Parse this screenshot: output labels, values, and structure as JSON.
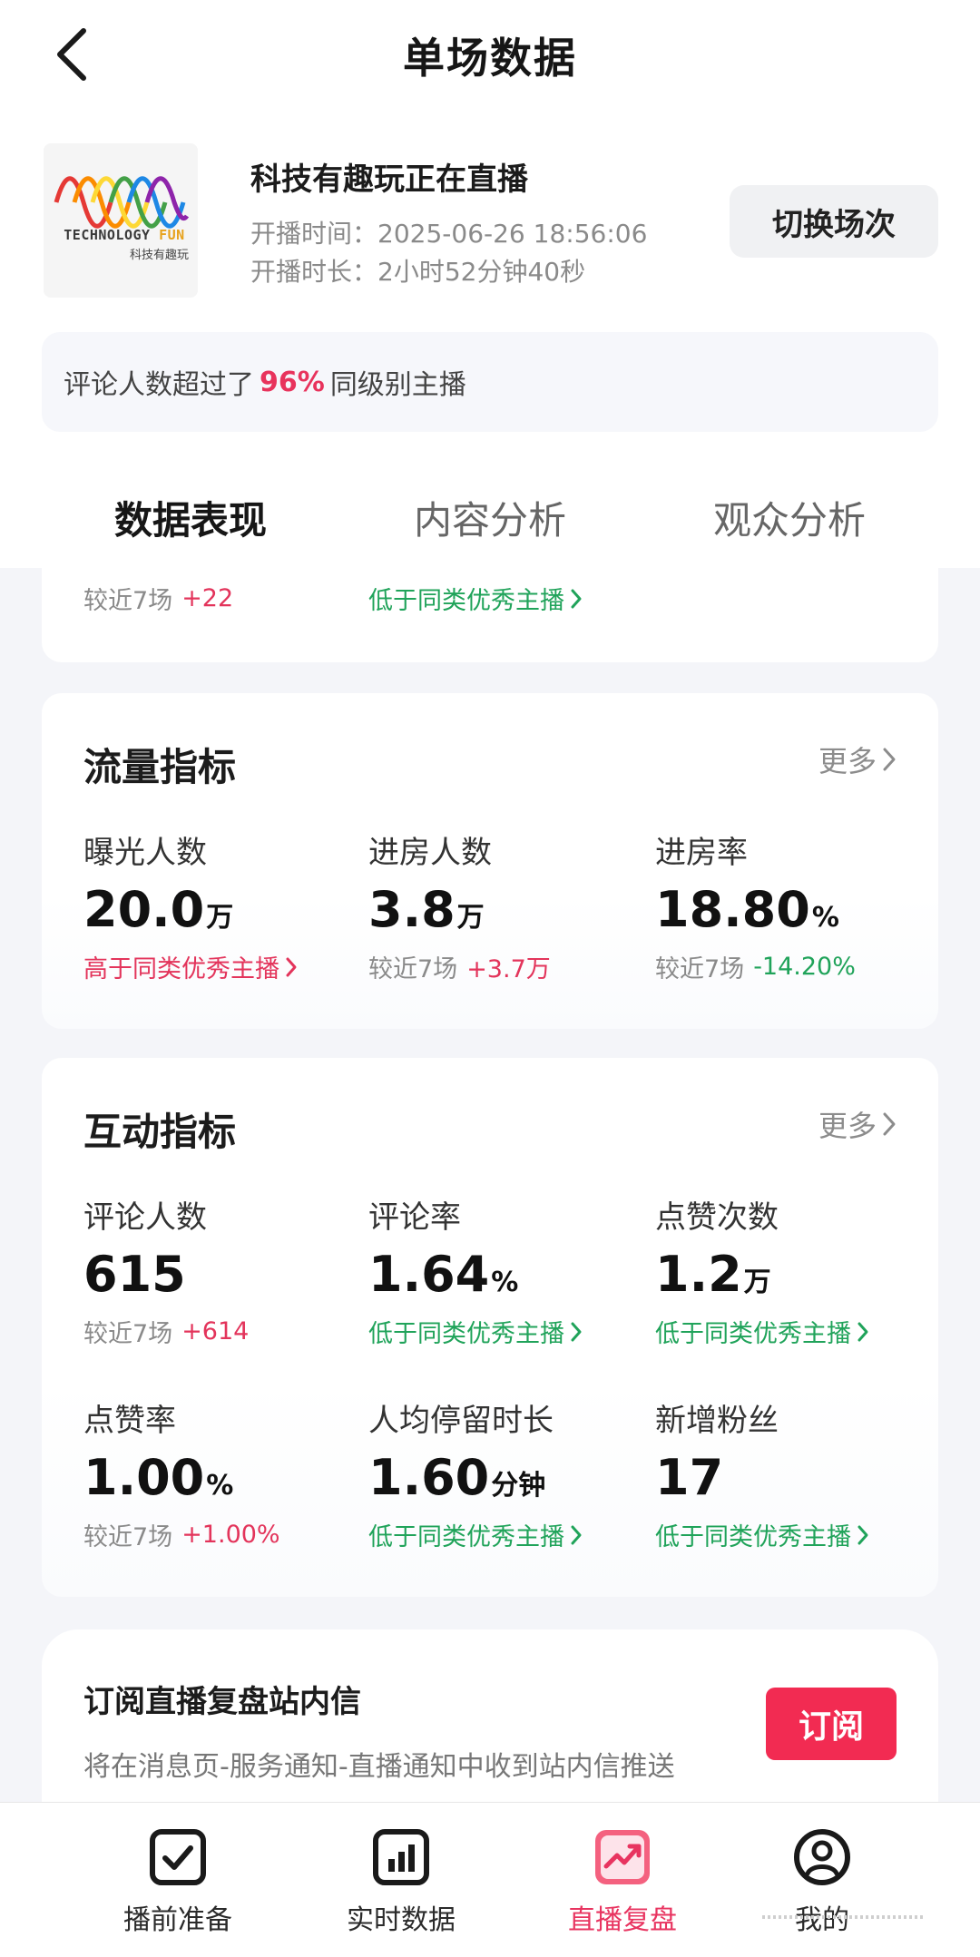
{
  "header": {
    "title": "单场数据",
    "back_icon": "chevron-left-icon"
  },
  "broadcast": {
    "logo": {
      "word1": "TECHNOLOGY",
      "word2": "FUN",
      "cn_text": "科技有趣玩",
      "colors": [
        "#e53935",
        "#fb8c00",
        "#fdd835",
        "#43a047",
        "#1e88e5",
        "#8e24aa"
      ]
    },
    "name": "科技有趣玩正在直播",
    "start_time_label": "开播时间：",
    "start_time": "2025-06-26 18:56:06",
    "duration_label": "开播时长：",
    "duration": "2小时52分钟40秒",
    "switch_label": "切换场次"
  },
  "notice": {
    "prefix": "评论人数超过了",
    "percent": "96%",
    "suffix": "同级别主播"
  },
  "tabs": [
    {
      "label": "数据表现",
      "active": true
    },
    {
      "label": "内容分析",
      "active": false
    },
    {
      "label": "观众分析",
      "active": false
    }
  ],
  "partial_card": {
    "left_sub_label": "较近7场",
    "left_sub_value": "+22",
    "middle_link": "低于同类优秀主播"
  },
  "traffic": {
    "title": "流量指标",
    "more": "更多",
    "metrics": [
      {
        "label": "曝光人数",
        "value": "20.0",
        "unit": "万",
        "sub_link": "高于同类优秀主播"
      },
      {
        "label": "进房人数",
        "value": "3.8",
        "unit": "万",
        "sub_label": "较近7场",
        "sub_value": "+3.7万"
      },
      {
        "label": "进房率",
        "value": "18.80",
        "unit": "%",
        "sub_label": "较近7场",
        "sub_value": "-14.20%"
      }
    ]
  },
  "interaction": {
    "title": "互动指标",
    "more": "更多",
    "metrics": [
      {
        "label": "评论人数",
        "value": "615",
        "unit": "",
        "sub_label": "较近7场",
        "sub_value": "+614"
      },
      {
        "label": "评论率",
        "value": "1.64",
        "unit": "%",
        "sub_link": "低于同类优秀主播"
      },
      {
        "label": "点赞次数",
        "value": "1.2",
        "unit": "万",
        "sub_link": "低于同类优秀主播"
      },
      {
        "label": "点赞率",
        "value": "1.00",
        "unit": "%",
        "sub_label": "较近7场",
        "sub_value": "+1.00%"
      },
      {
        "label": "人均停留时长",
        "value": "1.60",
        "unit": "分钟",
        "sub_link": "低于同类优秀主播"
      },
      {
        "label": "新增粉丝",
        "value": "17",
        "unit": "",
        "sub_link": "低于同类优秀主播"
      }
    ]
  },
  "subscription": {
    "title": "订阅直播复盘站内信",
    "description": "将在消息页-服务通知-直播通知中收到站内信推送",
    "button": "订阅"
  },
  "bottom_nav": [
    {
      "label": "播前准备",
      "icon": "checkbox-icon",
      "active": false
    },
    {
      "label": "实时数据",
      "icon": "bar-chart-icon",
      "active": false
    },
    {
      "label": "直播复盘",
      "icon": "trend-chart-icon",
      "active": true
    },
    {
      "label": "我的",
      "icon": "profile-icon",
      "active": false
    }
  ],
  "theme": {
    "accent": "#e83460",
    "positive": "#e3345b",
    "negative": "#20a35a"
  }
}
